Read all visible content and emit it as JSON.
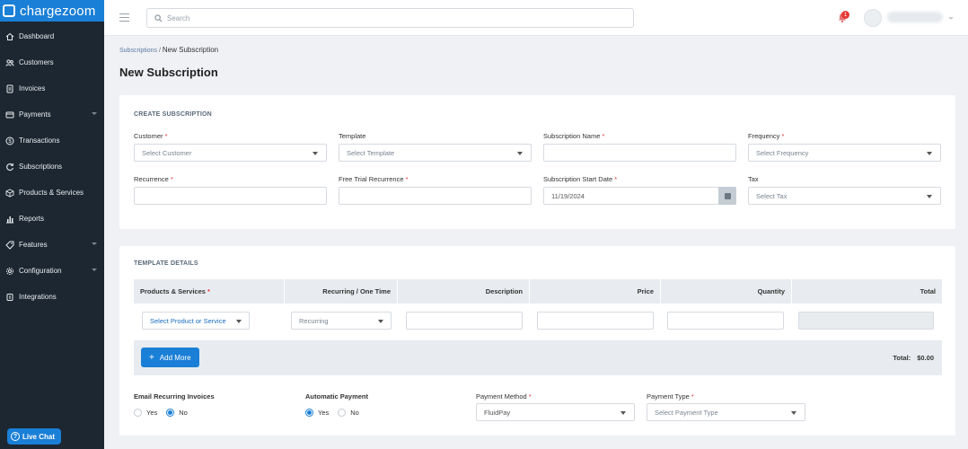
{
  "app": {
    "logo_text": "chargezoom"
  },
  "sidebar": {
    "items": [
      {
        "label": "Dashboard",
        "icon": "home-icon",
        "has_caret": false
      },
      {
        "label": "Customers",
        "icon": "users-icon",
        "has_caret": false
      },
      {
        "label": "Invoices",
        "icon": "invoice-icon",
        "has_caret": false
      },
      {
        "label": "Payments",
        "icon": "payments-icon",
        "has_caret": true
      },
      {
        "label": "Transactions",
        "icon": "dollar-icon",
        "has_caret": false
      },
      {
        "label": "Subscriptions",
        "icon": "refresh-icon",
        "has_caret": false
      },
      {
        "label": "Products & Services",
        "icon": "box-icon",
        "has_caret": false
      },
      {
        "label": "Reports",
        "icon": "bar-chart-icon",
        "has_caret": false
      },
      {
        "label": "Features",
        "icon": "tag-icon",
        "has_caret": true
      },
      {
        "label": "Configuration",
        "icon": "gear-icon",
        "has_caret": true
      },
      {
        "label": "Integrations",
        "icon": "plug-icon",
        "has_caret": false
      }
    ],
    "live_chat": "Live Chat"
  },
  "topbar": {
    "search_placeholder": "Search",
    "notification_count": "1"
  },
  "breadcrumb": {
    "parent": "Subscriptions",
    "separator": " / ",
    "current": "New Subscription"
  },
  "page": {
    "title": "New Subscription"
  },
  "create": {
    "section_title": "CREATE SUBSCRIPTION",
    "customer_label": "Customer",
    "customer_placeholder": "Select Customer",
    "template_label": "Template",
    "template_placeholder": "Select Template",
    "subscription_name_label": "Subscription Name",
    "frequency_label": "Frequency",
    "frequency_placeholder": "Select Frequency",
    "recurrence_label": "Recurrence",
    "free_trial_label": "Free Trial Recurrence",
    "start_date_label": "Subscription Start Date",
    "start_date_value": "11/19/2024",
    "tax_label": "Tax",
    "tax_placeholder": "Select Tax",
    "required_mark": "*"
  },
  "template": {
    "section_title": "TEMPLATE DETAILS",
    "columns": [
      "Products & Services",
      "Recurring / One Time",
      "Description",
      "Price",
      "Quantity",
      "Total"
    ],
    "product_placeholder": "Select Product or Service",
    "recurring_value": "Recurring",
    "add_more": "Add More",
    "total_label": "Total:",
    "total_value": "$0.00"
  },
  "options": {
    "email_label": "Email Recurring Invoices",
    "email_yes": "Yes",
    "email_no": "No",
    "email_selected": "No",
    "auto_label": "Automatic Payment",
    "auto_yes": "Yes",
    "auto_no": "No",
    "auto_selected": "Yes",
    "payment_method_label": "Payment Method",
    "payment_method_value": "FluidPay",
    "payment_type_label": "Payment Type",
    "payment_type_placeholder": "Select Payment Type"
  },
  "colors": {
    "sidebar_bg": "#1c2731",
    "brand_blue": "#1a7fd6",
    "required_red": "#e53935"
  }
}
